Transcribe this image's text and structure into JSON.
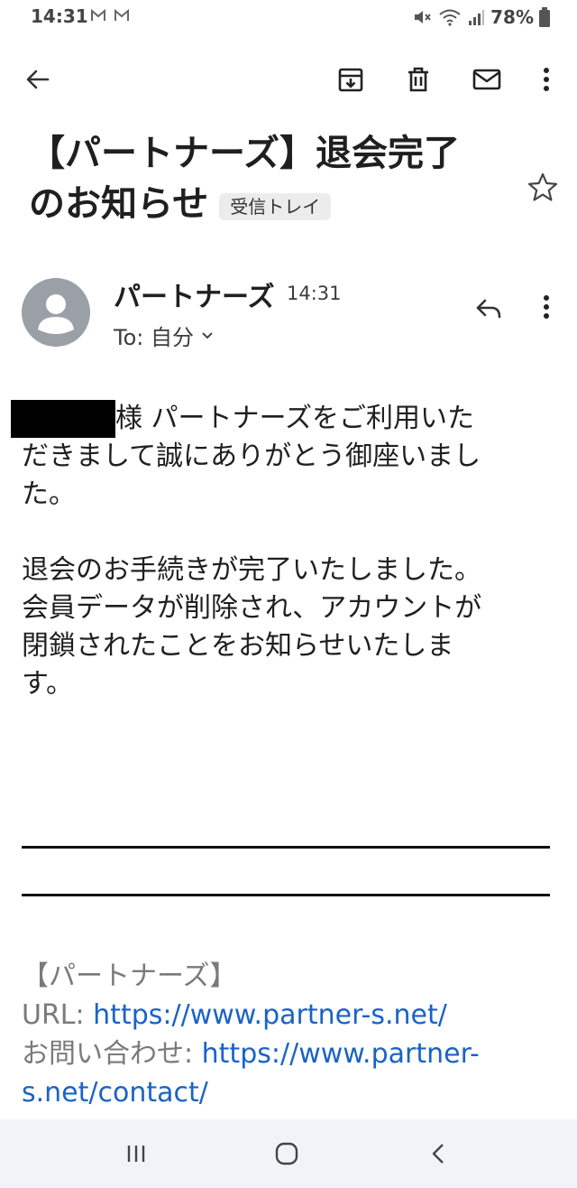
{
  "status_bar": {
    "time": "14:31",
    "battery": "78%"
  },
  "toolbar": {
    "back": "back-arrow-icon",
    "archive": "archive-icon",
    "delete": "trash-icon",
    "mark_unread": "mail-icon",
    "more": "more-vert-icon"
  },
  "email": {
    "subject_line1": "【パートナーズ】退会完了",
    "subject_line2": "のお知らせ",
    "label_chip": "受信トレイ",
    "sender_name": "パートナーズ",
    "sent_time": "14:31",
    "recipient": "To: 自分",
    "body": {
      "greeting_suffix": "様 パートナーズをご利用いた",
      "line2": "だきまして誠にありがとう御座いまし",
      "line3": "た。",
      "p2_line1": "退会のお手続きが完了いたしました。",
      "p2_line2": "会員データが削除され、アカウントが",
      "p2_line3": "閉鎖されたことをお知らせいたしま",
      "p2_line4": "す。"
    },
    "footer": {
      "company": "【パートナーズ】",
      "url_label": "URL: ",
      "url": "https://www.partner-s.net/",
      "contact_label": "お問い合わせ: ",
      "contact_url_part1": "https://www.partner-",
      "contact_url_part2": "s.net/contact/"
    }
  },
  "colors": {
    "link": "#1a63c6",
    "avatar_bg": "#9aa0a6",
    "chip_bg": "#ececec",
    "nav_bg": "#f1f3f8"
  }
}
